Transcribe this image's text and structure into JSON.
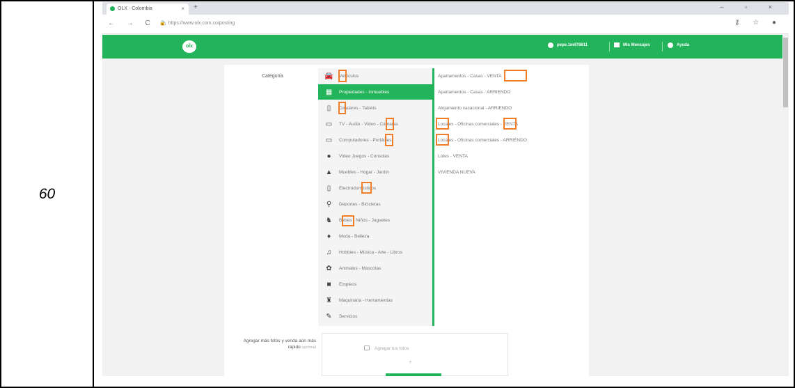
{
  "row_number": "60",
  "browser": {
    "tab_title": "OLX - Colombia",
    "tab_close": "×",
    "new_tab": "+",
    "window_controls": "– ▫ ×",
    "nav_icons": "← → C ⌂",
    "url": "https://www.olx.com.co/posting",
    "right_icons": "⚷ ☆ ●"
  },
  "header": {
    "logo": "olx",
    "user": "pepe.1mil78611",
    "messages": "Mis Mensajes",
    "help": "Ayuda"
  },
  "form": {
    "category_label": "Categoría",
    "categories": [
      {
        "label": "Vehículos",
        "icon": "car-icon",
        "glyph": "🚘",
        "active": false
      },
      {
        "label": "Propiedades - Inmuebles",
        "icon": "building-icon",
        "glyph": "▦",
        "active": true
      },
      {
        "label": "Celulares - Tablets",
        "icon": "phone-icon",
        "glyph": "▯",
        "active": false
      },
      {
        "label": "TV - Audio - Video - Cámaras",
        "icon": "tv-icon",
        "glyph": "▭",
        "active": false
      },
      {
        "label": "Computadores - Portátiles",
        "icon": "laptop-icon",
        "glyph": "▭",
        "active": false
      },
      {
        "label": "Video Juegos - Consolas",
        "icon": "gamepad-icon",
        "glyph": "●",
        "active": false
      },
      {
        "label": "Muebles - Hogar - Jardín",
        "icon": "sofa-icon",
        "glyph": "▲",
        "active": false
      },
      {
        "label": "Electrodomésticos",
        "icon": "appliance-icon",
        "glyph": "▯",
        "active": false
      },
      {
        "label": "Deportes - Bicicletas",
        "icon": "bicycle-icon",
        "glyph": "⚲",
        "active": false
      },
      {
        "label": "Bebés - Niños - Juguetes",
        "icon": "stroller-icon",
        "glyph": "♞",
        "active": false
      },
      {
        "label": "Moda - Belleza",
        "icon": "dress-icon",
        "glyph": "♦",
        "active": false
      },
      {
        "label": "Hobbies - Música - Arte - Libros",
        "icon": "music-icon",
        "glyph": "♫",
        "active": false
      },
      {
        "label": "Animales - Mascotas",
        "icon": "paw-icon",
        "glyph": "✿",
        "active": false
      },
      {
        "label": "Empleos",
        "icon": "briefcase-icon",
        "glyph": "■",
        "active": false
      },
      {
        "label": "Maquinaria - Herramientas",
        "icon": "tractor-icon",
        "glyph": "♜",
        "active": false
      },
      {
        "label": "Servicios",
        "icon": "wrench-icon",
        "glyph": "✎",
        "active": false
      }
    ],
    "subcategories": [
      "Apartamentos - Casas - VENTA",
      "Apartamentos - Casas - ARRIENDO",
      "Alojamiento vacacional - ARRIENDO",
      "Locales - Oficinas comerciales - VENTA",
      "Locales - Oficinas comerciales - ARRIENDO",
      "Lotes - VENTA",
      "VIVIENDA NUEVA"
    ],
    "photo_label": "Agregar más fotos y venda aún más rápido",
    "photo_label_small": "opcional",
    "photo_button": "Agregar tus fotos",
    "photo_plus": "+"
  },
  "colors": {
    "brand_green": "#23b35a",
    "highlight_orange": "#ef7d29"
  }
}
